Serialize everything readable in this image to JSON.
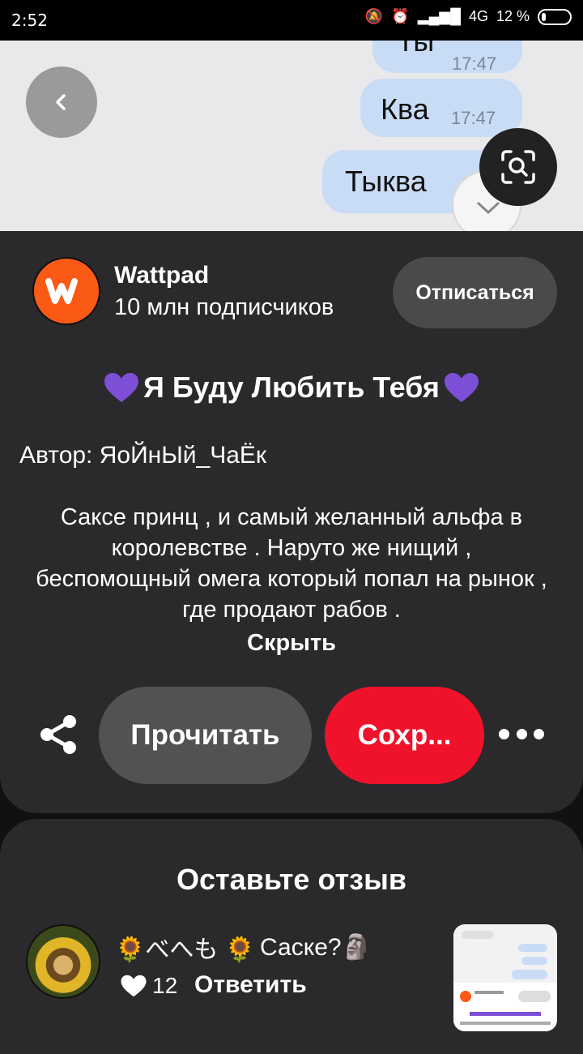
{
  "status": {
    "time": "2:52",
    "network": "4G",
    "battery": "12 %"
  },
  "image": {
    "bubbles": [
      {
        "text": "Ты",
        "time": "17:47"
      },
      {
        "text": "Ква",
        "time": "17:47"
      },
      {
        "text": "Тыква"
      }
    ],
    "icons": {
      "back": "chevron-left-icon",
      "lens": "visual-search-icon"
    }
  },
  "source": {
    "name": "Wattpad",
    "subscribers": "10 млн подписчиков",
    "unsubscribe_label": "Отписаться"
  },
  "pin": {
    "title": "Я Буду Любить Тебя",
    "author": "Автор: ЯоЙнЫй_ЧаЁк",
    "description": "Саксе принц , и самый желанный альфа в королевстве . Наруто же нищий , беспомощный омега который попал на рынок , где продают рабов .",
    "hide_label": "Скрыть"
  },
  "actions": {
    "read_label": "Прочитать",
    "save_label": "Сохр..."
  },
  "reviews": {
    "title": "Оставьте отзыв",
    "comment": {
      "author": "🌻べへも 🌻",
      "text": "Саске?🗿",
      "likes": "12",
      "reply_label": "Ответить"
    }
  },
  "colors": {
    "save": "#f0122b",
    "card": "#2a292b",
    "accent_purple": "#7d4fd6",
    "wattpad": "#fa5a16"
  }
}
